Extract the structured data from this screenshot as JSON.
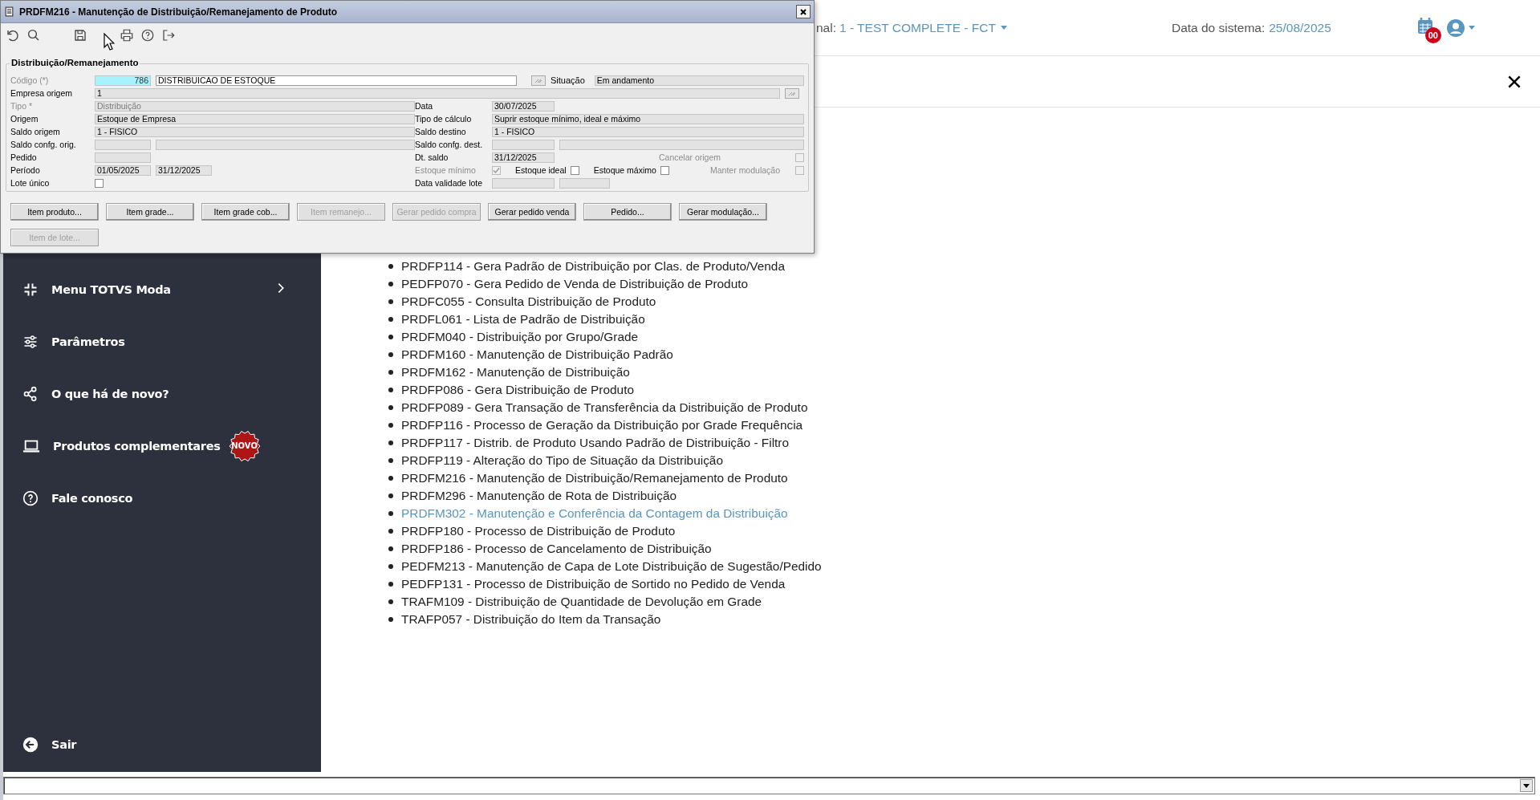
{
  "header": {
    "filial_label": "nal:",
    "filial_value": "1 - TEST COMPLETE - FCT",
    "date_label": "Data do sistema:",
    "date_value": "25/08/2025",
    "calendar_badge": "00"
  },
  "sidebar": {
    "items": [
      {
        "label": "Menu TOTVS Moda",
        "expandable": true
      },
      {
        "label": "Parâmetros",
        "expandable": false
      },
      {
        "label": "O que há de novo?",
        "expandable": false
      },
      {
        "label": "Produtos complementares",
        "expandable": false,
        "badge": "NOVO"
      },
      {
        "label": "Fale conosco",
        "expandable": false
      }
    ],
    "exit": "Sair"
  },
  "programs": [
    {
      "text": "PRDFP114 - Gera Padrão de Distribuição por Clas. de Produto/Venda",
      "highlighted": false
    },
    {
      "text": "PEDFP070 - Gera Pedido de Venda de Distribuição de Produto",
      "highlighted": false
    },
    {
      "text": "PRDFC055 - Consulta Distribuição de Produto",
      "highlighted": false
    },
    {
      "text": "PRDFL061 - Lista de Padrão de Distribuição",
      "highlighted": false
    },
    {
      "text": "PRDFM040 - Distribuição por Grupo/Grade",
      "highlighted": false
    },
    {
      "text": "PRDFM160 - Manutenção de Distribuição Padrão",
      "highlighted": false
    },
    {
      "text": "PRDFM162 - Manutenção de Distribuição",
      "highlighted": false
    },
    {
      "text": "PRDFP086 - Gera Distribuição de Produto",
      "highlighted": false
    },
    {
      "text": "PRDFP089 - Gera Transação de Transferência da Distribuição de Produto",
      "highlighted": false
    },
    {
      "text": "PRDFP116 - Processo de Geração da Distribuição por Grade Frequência",
      "highlighted": false
    },
    {
      "text": "PRDFP117 - Distrib. de Produto Usando Padrão de Distribuição - Filtro",
      "highlighted": false
    },
    {
      "text": "PRDFP119 - Alteração do Tipo de Situação da Distribuição",
      "highlighted": false
    },
    {
      "text": "PRDFM216 - Manutenção de Distribuição/Remanejamento de Produto",
      "highlighted": false
    },
    {
      "text": "PRDFM296 - Manutenção de Rota de Distribuição",
      "highlighted": false
    },
    {
      "text": "PRDFM302 - Manutenção e Conferência da Contagem da Distribuição",
      "highlighted": true
    },
    {
      "text": "PRDFP180 - Processo de Distribuição de Produto",
      "highlighted": false
    },
    {
      "text": "PRDFP186 - Processo de Cancelamento de Distribuição",
      "highlighted": false
    },
    {
      "text": "PEDFM213 - Manutenção de Capa de Lote Distribuição de Sugestão/Pedido",
      "highlighted": false
    },
    {
      "text": "PEDFP131 - Processo de Distribuição de Sortido no Pedido de Venda",
      "highlighted": false
    },
    {
      "text": "TRAFM109 - Distribuição de Quantidade de Devolução em Grade",
      "highlighted": false
    },
    {
      "text": "TRAFP057 - Distribuição do Item da Transação",
      "highlighted": false
    }
  ],
  "dialog": {
    "title": "PRDFM216 - Manutenção de Distribuição/Remanejamento de Produto",
    "group_title": "Distribuição/Remanejamento",
    "codigo": {
      "label": "Código (*)",
      "disabled": true,
      "code": "786",
      "description": "DISTRIBUICAO DE ESTOQUE"
    },
    "situacao": {
      "label": "Situação",
      "value": "Em andamento"
    },
    "empresa_origem": {
      "label": "Empresa origem",
      "value": "1"
    },
    "tipo": {
      "label": "Tipo *",
      "disabled": true,
      "value": "Distribuição"
    },
    "data": {
      "label": "Data",
      "value": "30/07/2025"
    },
    "origem": {
      "label": "Origem",
      "value": "Estoque de Empresa"
    },
    "tipo_calculo": {
      "label": "Tipo de cálculo",
      "value": "Suprir estoque mínimo, ideal e máximo"
    },
    "saldo_origem": {
      "label": "Saldo origem",
      "value": "1 - FISICO"
    },
    "saldo_destino": {
      "label": "Saldo destino",
      "value": "1 - FISICO"
    },
    "saldo_confg_orig": {
      "label": "Saldo confg. orig."
    },
    "saldo_confg_dest": {
      "label": "Saldo confg. dest."
    },
    "pedido": {
      "label": "Pedido"
    },
    "dt_saldo": {
      "label": "Dt. saldo",
      "value": "31/12/2025"
    },
    "cancelar_origem": {
      "label": "Cancelar origem",
      "disabled": true,
      "checked": false
    },
    "periodo": {
      "label": "Período",
      "from": "01/05/2025",
      "to": "31/12/2025"
    },
    "estoque_minimo": {
      "label": "Estoque mínimo",
      "disabled": true,
      "checked": true
    },
    "estoque_ideal": {
      "label": "Estoque ideal",
      "checked": false
    },
    "estoque_maximo": {
      "label": "Estoque máximo",
      "checked": false
    },
    "manter_modulacao": {
      "label": "Manter modulação",
      "disabled": true,
      "checked": false
    },
    "lote_unico": {
      "label": "Lote único",
      "checked": false
    },
    "data_validade_lote": {
      "label": "Data validade lote"
    },
    "buttons": [
      {
        "label": "Item produto...",
        "disabled": false
      },
      {
        "label": "Item grade...",
        "disabled": false
      },
      {
        "label": "Item grade cob...",
        "disabled": false
      },
      {
        "label": "Item remanejo...",
        "disabled": true
      },
      {
        "label": "Gerar pedido compra",
        "disabled": true
      },
      {
        "label": "Gerar pedido venda",
        "disabled": false
      },
      {
        "label": "Pedido...",
        "disabled": false
      },
      {
        "label": "Gerar modulação...",
        "disabled": false
      },
      {
        "label": "Item de lote...",
        "disabled": true
      }
    ]
  }
}
